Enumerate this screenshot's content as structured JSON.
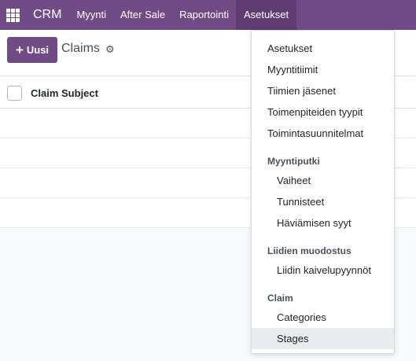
{
  "topbar": {
    "apps_icon": "apps-grid-icon",
    "brand": "CRM",
    "nav": [
      "Myynti",
      "After Sale",
      "Raportointi",
      "Asetukset"
    ]
  },
  "control": {
    "new_label": "Uusi",
    "breadcrumb": "Claims",
    "gear_icon": "gear-icon"
  },
  "list": {
    "columns": [
      "Claim Subject"
    ]
  },
  "dropdown": {
    "items_top": [
      "Asetukset",
      "Myyntitiimit",
      "Tiimien jäsenet",
      "Toimenpiteiden tyypit",
      "Toimintasuunnitelmat"
    ],
    "sections": [
      {
        "header": "Myyntiputki",
        "items": [
          "Vaiheet",
          "Tunnisteet",
          "Häviämisen syyt"
        ]
      },
      {
        "header": "Liidien muodostus",
        "items": [
          "Liidin kaivelupyynnöt"
        ]
      },
      {
        "header": "Claim",
        "items": [
          "Categories",
          "Stages"
        ]
      }
    ]
  },
  "colors": {
    "brand": "#714b86",
    "brand_active": "#5f3d72",
    "hover": "#e9ecef"
  }
}
